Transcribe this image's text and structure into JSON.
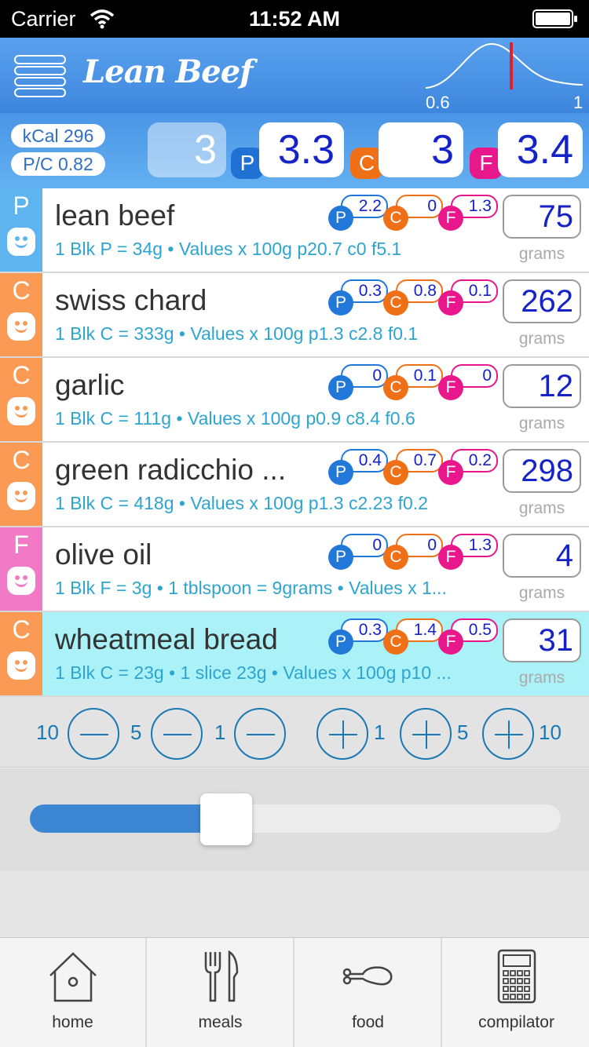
{
  "status_bar": {
    "carrier": "Carrier",
    "time": "11:52 AM"
  },
  "header": {
    "title": "Lean Beef",
    "curve_min_label": "0.6",
    "curve_max_label": "1"
  },
  "summary": {
    "kcal": "kCal 296",
    "pc_ratio": "P/C 0.82",
    "total_blocks": "3",
    "protein_letter": "P",
    "protein_blocks": "3.3",
    "carb_letter": "C",
    "carb_blocks": "3",
    "fat_letter": "F",
    "fat_blocks": "3.4"
  },
  "colors": {
    "protein": "#2178d8",
    "carb": "#f07018",
    "fat": "#e8188c",
    "side_protein": "#5eb4ee",
    "side_carb": "#fa9a55",
    "side_fat": "#f07ac6",
    "selected_row": "#aaf2f8"
  },
  "list": {
    "grams_label": "grams",
    "items": [
      {
        "type": "P",
        "name": "lean beef",
        "desc": "1 Blk P = 34g • Values x 100g p20.7 c0 f5.1",
        "p": "2.2",
        "c": "0",
        "f": "1.3",
        "grams": "75",
        "selected": false
      },
      {
        "type": "C",
        "name": "swiss chard",
        "desc": "1 Blk C = 333g • Values x 100g p1.3 c2.8 f0.1",
        "p": "0.3",
        "c": "0.8",
        "f": "0.1",
        "grams": "262",
        "selected": false
      },
      {
        "type": "C",
        "name": "garlic",
        "desc": "1 Blk C = 111g • Values x 100g p0.9 c8.4 f0.6",
        "p": "0",
        "c": "0.1",
        "f": "0",
        "grams": "12",
        "selected": false
      },
      {
        "type": "C",
        "name": "green radicchio ...",
        "desc": "1 Blk C = 418g • Values x 100g p1.3 c2.23 f0.2",
        "p": "0.4",
        "c": "0.7",
        "f": "0.2",
        "grams": "298",
        "selected": false
      },
      {
        "type": "F",
        "name": "olive oil",
        "desc": "1 Blk F = 3g • 1 tblspoon = 9grams • Values x 1...",
        "p": "0",
        "c": "0",
        "f": "1.3",
        "grams": "4",
        "selected": false
      },
      {
        "type": "C",
        "name": "wheatmeal bread",
        "desc": "1 Blk C = 23g • 1 slice 23g • Values x 100g p10 ...",
        "p": "0.3",
        "c": "1.4",
        "f": "0.5",
        "grams": "31",
        "selected": true
      }
    ]
  },
  "steps": {
    "minus_10": "10",
    "minus_5": "5",
    "minus_1": "1",
    "plus_1": "1",
    "plus_5": "5",
    "plus_10": "10"
  },
  "slider": {
    "value": 0.37
  },
  "tabs": [
    {
      "label": "home",
      "icon": "house-icon"
    },
    {
      "label": "meals",
      "icon": "fork-knife-icon"
    },
    {
      "label": "food",
      "icon": "drumstick-icon"
    },
    {
      "label": "compilator",
      "icon": "calculator-icon"
    }
  ]
}
